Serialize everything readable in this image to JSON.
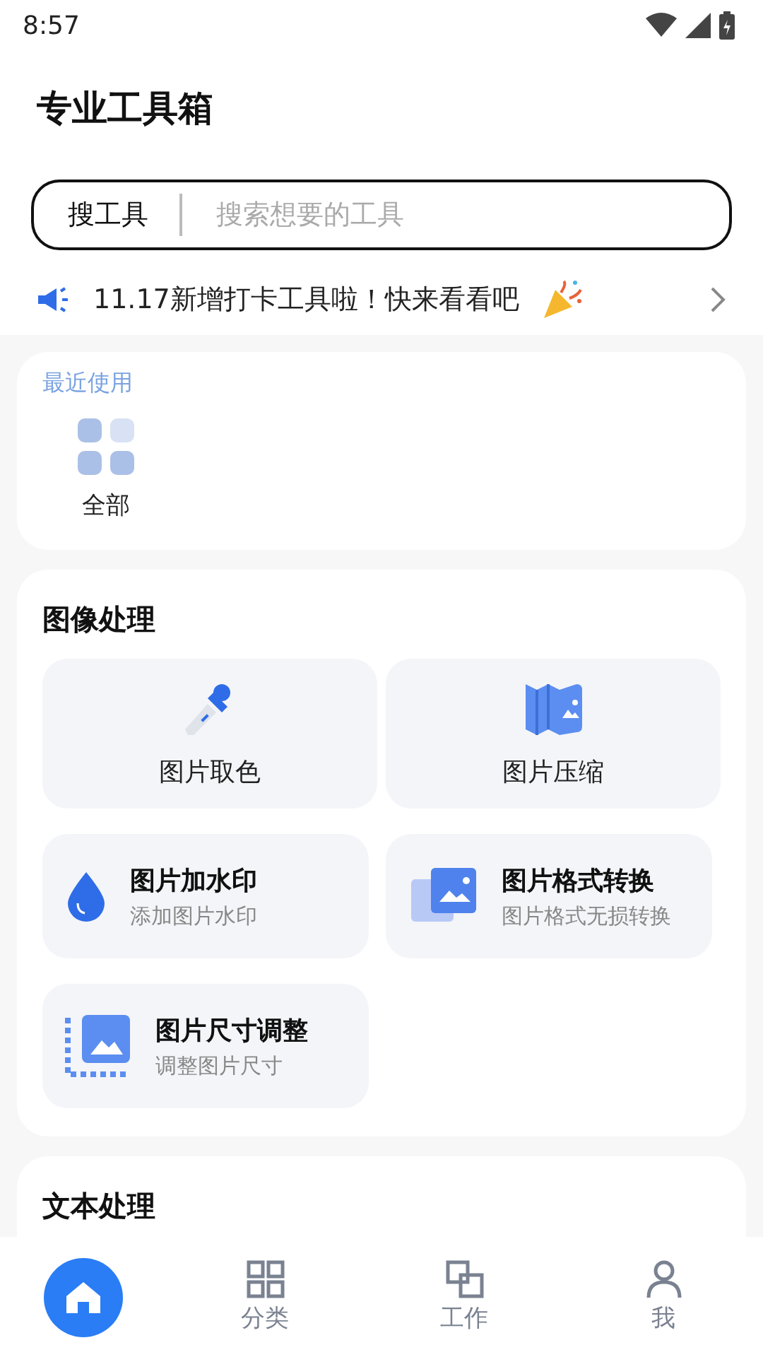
{
  "status_bar": {
    "time": "8:57"
  },
  "title": "专业工具箱",
  "search": {
    "label": "搜工具",
    "placeholder": "搜索想要的工具"
  },
  "notice": {
    "text": "11.17新增打卡工具啦！快来看看吧"
  },
  "recent": {
    "title": "最近使用",
    "items": [
      {
        "label": "全部"
      }
    ]
  },
  "sections": [
    {
      "title": "图像处理",
      "tools": [
        {
          "kind": "tile",
          "name": "图片取色"
        },
        {
          "kind": "tile",
          "name": "图片压缩"
        },
        {
          "kind": "row",
          "name": "图片加水印",
          "desc": "添加图片水印"
        },
        {
          "kind": "row",
          "name": "图片格式转换",
          "desc": "图片格式无损转换"
        },
        {
          "kind": "row",
          "name": "图片尺寸调整",
          "desc": "调整图片尺寸"
        }
      ]
    },
    {
      "title": "文本处理"
    }
  ],
  "nav": [
    {
      "selected": true
    },
    {
      "label": "分类",
      "selected": false
    },
    {
      "label": "工作",
      "selected": false
    },
    {
      "label": "我",
      "selected": false
    }
  ]
}
